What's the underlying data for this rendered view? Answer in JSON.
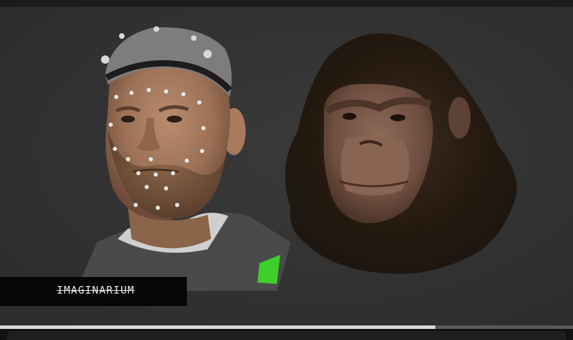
{
  "video": {
    "watermark_text": "IMAGINARIUM",
    "progress_fraction": 0.76
  },
  "subjects": {
    "left": "actor-face-scan-icon",
    "right": "ape-head-render-icon"
  },
  "colors": {
    "background": "#333333",
    "progress_played": "#d9d9d9",
    "progress_remaining": "#5a5a5a",
    "marker_green": "#3ecf2a"
  }
}
